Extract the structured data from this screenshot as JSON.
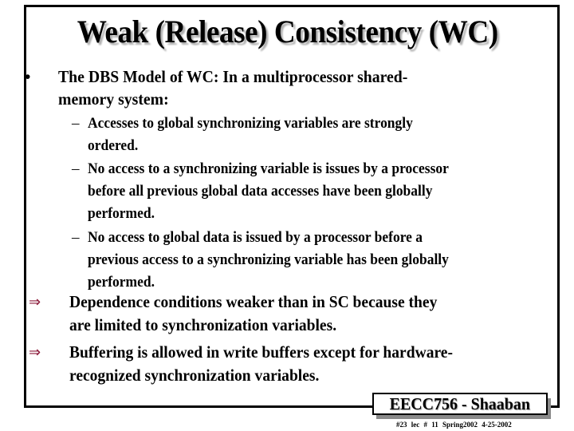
{
  "slide": {
    "title": "Weak (Release) Consistency (WC)",
    "bullet_symbol": "•",
    "dash_symbol": "–",
    "arrow_symbol": "⇒",
    "arrow_color": "#8b1a3a",
    "main_point": {
      "line1": "The DBS Model of WC:  In a multiprocessor shared-",
      "line2": "memory system:"
    },
    "sub_points": [
      {
        "lines": [
          "Accesses to global synchronizing variables are strongly",
          "ordered."
        ]
      },
      {
        "lines": [
          "No access to a synchronizing variable is issues by a processor",
          "before all previous global data accesses have been globally",
          "performed."
        ]
      },
      {
        "lines": [
          "No access to global data is issued by a processor before a",
          "previous access to a synchronizing variable has been globally",
          "performed."
        ]
      }
    ],
    "implications": [
      {
        "lines": [
          "Dependence conditions weaker than in SC because they",
          "are limited to synchronization variables."
        ]
      },
      {
        "lines": [
          "Buffering is allowed in write buffers except for hardware-",
          "recognized synchronization variables."
        ]
      }
    ],
    "footer": {
      "course_label": "EECC756 - Shaaban",
      "footnote": "#23  lec # 11   Spring2002   4-25-2002"
    }
  }
}
